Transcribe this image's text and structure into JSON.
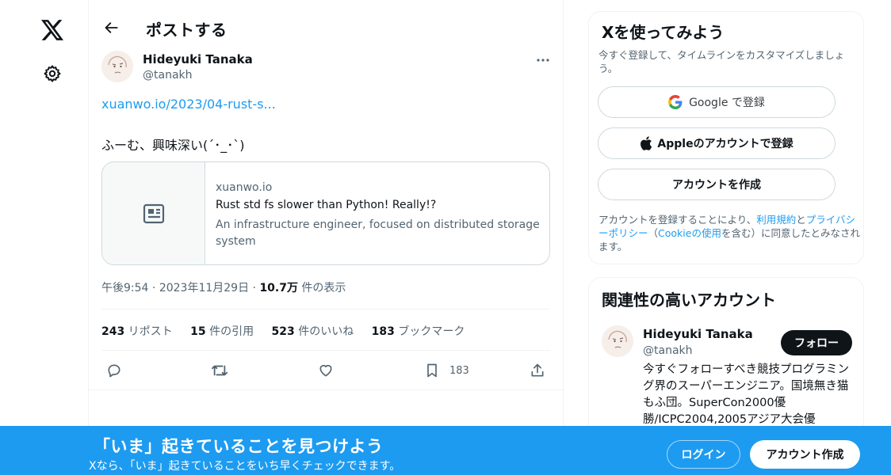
{
  "nav": {
    "logo_icon": "x-logo-icon",
    "settings_icon": "gear-icon"
  },
  "header": {
    "title": "ポストする",
    "back_icon": "arrow-left-icon"
  },
  "post": {
    "author_name": "Hideyuki Tanaka",
    "author_handle": "@tanakh",
    "link_text": "xuanwo.io/2023/04-rust-s...",
    "text": "ふーむ、興味深い(´･_･`)",
    "card": {
      "domain": "xuanwo.io",
      "title": "Rust std fs slower than Python! Really!?",
      "description": "An infrastructure engineer, focused on distributed storage system"
    },
    "time": "午後9:54",
    "separator": " · ",
    "date": "2023年11月29日",
    "views_count": "10.7万",
    "views_label": " 件の表示",
    "stats": [
      {
        "count": "243",
        "label": " リポスト"
      },
      {
        "count": "15",
        "label": " 件の引用"
      },
      {
        "count": "523",
        "label": " 件のいいね"
      },
      {
        "count": "183",
        "label": " ブックマーク"
      }
    ],
    "bookmark_count": "183"
  },
  "signup": {
    "title": "Xを使ってみよう",
    "subtitle": "今すぐ登録して、タイムラインをカスタマイズしましょう。",
    "google_label": "Google で登録",
    "apple_label": "Appleのアカウントで登録",
    "create_label": "アカウントを作成",
    "terms_prefix": "アカウントを登録することにより、",
    "terms_link": "利用規約",
    "terms_and": "と",
    "privacy_link": "プライバシーポリシー",
    "terms_paren_open": "（",
    "cookie_link": "Cookieの使用",
    "terms_suffix": "を含む）に同意したとみなされます。"
  },
  "related": {
    "title": "関連性の高いアカウント",
    "name": "Hideyuki Tanaka",
    "handle": "@tanakh",
    "follow_label": "フォロー",
    "bio": "今すぐフォローすべき競技プログラミング界のスーパーエンジニア。国境無き猫もふ団。SuperCon2000優勝/ICPC2004,2005アジア大会優"
  },
  "banner": {
    "title": "「いま」起きていることを見つけよう",
    "subtitle": "Xなら、「いま」起きていることをいち早くチェックできます。",
    "login_label": "ログイン",
    "create_label": "アカウント作成"
  },
  "colors": {
    "accent": "#1d9bf0",
    "text": "#0f1419",
    "muted": "#536471",
    "border": "#cfd9de"
  }
}
